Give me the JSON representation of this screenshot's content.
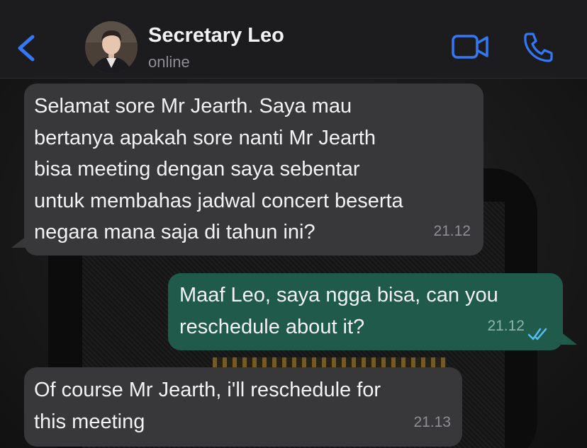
{
  "header": {
    "contact_name": "Secretary Leo",
    "status": "online",
    "back_icon": "chevron-left-icon",
    "video_icon": "video-camera-icon",
    "call_icon": "phone-icon",
    "accent_color": "#3478f6"
  },
  "messages": [
    {
      "direction": "incoming",
      "text": "Selamat sore Mr Jearth. Saya mau\nbertanya apakah sore nanti Mr Jearth\nbisa meeting dengan saya sebentar\nuntuk membahas jadwal concert beserta\nnegara mana saja di tahun ini?",
      "time": "21.12"
    },
    {
      "direction": "outgoing",
      "text": "Maaf Leo, saya ngga bisa, can you\nreschedule about it?",
      "time": "21.12",
      "read_icon": "double-check-icon"
    },
    {
      "direction": "incoming",
      "text": "Of course Mr Jearth, i'll reschedule for\nthis meeting",
      "time": "21.13"
    }
  ],
  "colors": {
    "incoming_bubble": "#38383a",
    "outgoing_bubble": "#1f5a4b",
    "read_ticks": "#53bdeb"
  }
}
